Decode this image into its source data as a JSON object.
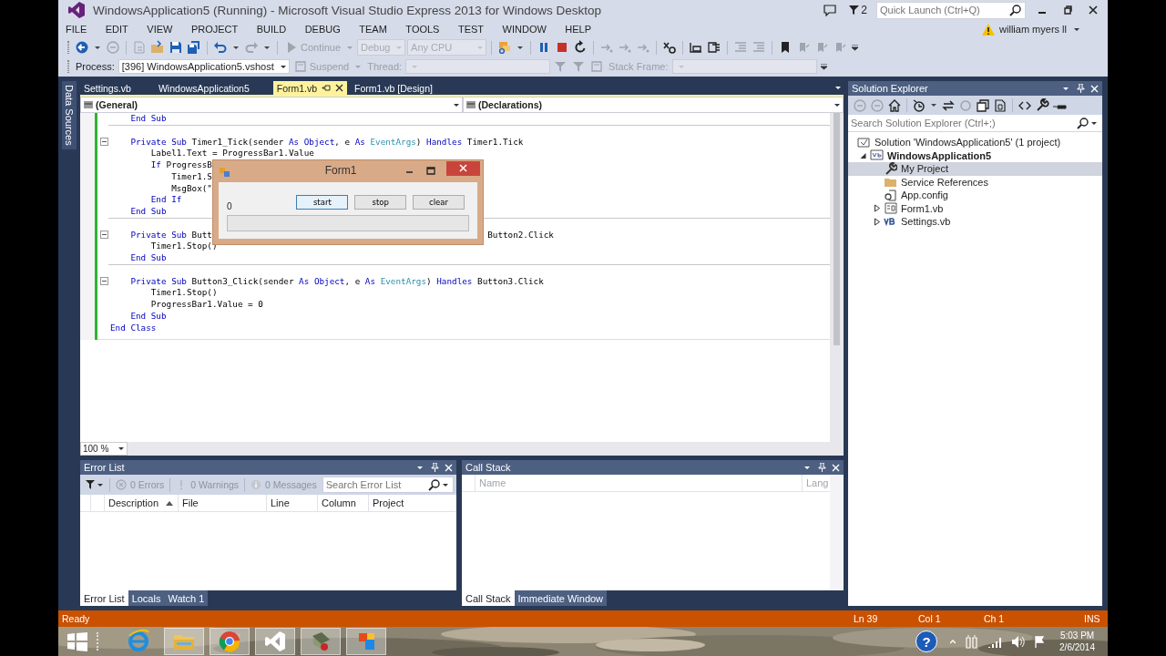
{
  "window": {
    "title": "WindowsApplication5 (Running) - Microsoft Visual Studio Express 2013 for Windows Desktop",
    "notification_count": "2",
    "quick_launch": {
      "placeholder": "Quick Launch (Ctrl+Q)"
    },
    "user": "william myers ll"
  },
  "menu": [
    "FILE",
    "EDIT",
    "VIEW",
    "PROJECT",
    "BUILD",
    "DEBUG",
    "TEAM",
    "TOOLS",
    "TEST",
    "WINDOW",
    "HELP"
  ],
  "toolbar_standard": [
    {
      "kind": "tools"
    },
    {
      "kind": "button",
      "label": "Continue",
      "disabled": true
    },
    {
      "kind": "combo",
      "value": "Debug",
      "disabled": true
    },
    {
      "kind": "combo",
      "value": "Any CPU",
      "disabled": true
    },
    {
      "kind": "tools"
    }
  ],
  "toolbar_debug_location": [
    {
      "kind": "label",
      "text": "Process:",
      "disabled": false
    },
    {
      "kind": "combo",
      "value": "[396] WindowsApplication5.vshost",
      "disabled": false
    },
    {
      "kind": "button",
      "label": "Suspend",
      "disabled": true
    },
    {
      "kind": "label",
      "text": "Thread:",
      "disabled": true
    },
    {
      "kind": "combo",
      "disabled": true
    },
    {
      "kind": "tools"
    },
    {
      "kind": "label",
      "text": "Stack Frame:",
      "disabled": true
    },
    {
      "kind": "combo",
      "disabled": true
    }
  ],
  "side_tab": "Data Sources",
  "editor": {
    "tabs": [
      {
        "label": "Settings.vb",
        "selected": false
      },
      {
        "label": "WindowsApplication5",
        "selected": false
      },
      {
        "label": "Form1.vb",
        "selected": true
      },
      {
        "label": "Form1.vb [Design]",
        "selected": false
      }
    ],
    "member_dropdowns": [
      "(General)",
      "(Declarations)"
    ],
    "code": {
      "members": [
        {
          "tokens": [
            {
              "text": "End Sub",
              "kind": "keyword"
            }
          ]
        },
        {
          "tokens": [
            {
              "text": "Private Sub",
              "kind": "keyword"
            },
            {
              "text": " Timer1_Tick(sender ",
              "kind": "plain"
            },
            {
              "text": "As Object",
              "kind": "keyword"
            },
            {
              "text": ", e ",
              "kind": "plain"
            },
            {
              "text": "As",
              "kind": "keyword"
            },
            {
              "text": " EventArgs",
              "kind": "type"
            },
            {
              "text": ") ",
              "kind": "plain"
            },
            {
              "text": "Handles",
              "kind": "keyword"
            },
            {
              "text": " Timer1.Tick",
              "kind": "plain"
            }
          ],
          "children": [
            {
              "tokens": [
                {
                  "text": "Label1.Text = ProgressBar1.Value",
                  "kind": "plain"
                }
              ]
            },
            {
              "tokens": [
                {
                  "text": "If",
                  "kind": "keyword"
                },
                {
                  "text": " ProgressB",
                  "kind": "plain"
                }
              ],
              "children": [
                {
                  "tokens": [
                    {
                      "text": "Timer1.S",
                      "kind": "plain"
                    }
                  ]
                },
                {
                  "tokens": [
                    {
                      "text": "MsgBox(\"",
                      "kind": "plain"
                    }
                  ]
                }
              ]
            },
            {
              "tokens": [
                {
                  "text": "End If",
                  "kind": "keyword"
                }
              ]
            }
          ]
        },
        {
          "tokens": [
            {
              "text": "End Sub",
              "kind": "keyword"
            }
          ]
        },
        {
          "tokens": [
            {
              "text": "Private Sub",
              "kind": "keyword"
            },
            {
              "text": " Butt",
              "kind": "plain"
            }
          ],
          "tail_tokens": [
            {
              "text": "Button2.Click",
              "kind": "plain"
            }
          ],
          "children": [
            {
              "tokens": [
                {
                  "text": "Timer1.Stop()",
                  "kind": "plain"
                }
              ]
            }
          ]
        },
        {
          "tokens": [
            {
              "text": "End Sub",
              "kind": "keyword"
            }
          ]
        },
        {
          "tokens": [
            {
              "text": "Private Sub",
              "kind": "keyword"
            },
            {
              "text": " Button3_Click(sender ",
              "kind": "plain"
            },
            {
              "text": "As Object",
              "kind": "keyword"
            },
            {
              "text": ", e ",
              "kind": "plain"
            },
            {
              "text": "As",
              "kind": "keyword"
            },
            {
              "text": " EventArgs",
              "kind": "type"
            },
            {
              "text": ") ",
              "kind": "plain"
            },
            {
              "text": "Handles",
              "kind": "keyword"
            },
            {
              "text": " Button3.Click",
              "kind": "plain"
            }
          ],
          "children": [
            {
              "tokens": [
                {
                  "text": "Timer1.Stop()",
                  "kind": "plain"
                }
              ]
            },
            {
              "tokens": [
                {
                  "text": "ProgressBar1.Value = 0",
                  "kind": "plain"
                }
              ]
            }
          ]
        },
        {
          "tokens": [
            {
              "text": "End Sub",
              "kind": "keyword"
            }
          ]
        }
      ],
      "closing": [
        {
          "text": "End Class",
          "kind": "keyword"
        }
      ]
    },
    "zoom": "100 %"
  },
  "running_form": {
    "title": "Form1",
    "label": "0",
    "buttons": [
      {
        "label": "start",
        "focused": true
      },
      {
        "label": "stop",
        "focused": false
      },
      {
        "label": "clear",
        "focused": false
      }
    ],
    "progress": {
      "level": 0
    }
  },
  "error_list": {
    "title": "Error List",
    "filters": [
      {
        "label": "0 Errors",
        "kind": "errors",
        "disabled": true
      },
      {
        "label": "0 Warnings",
        "kind": "warnings",
        "disabled": true
      },
      {
        "label": "0 Messages",
        "kind": "messages",
        "disabled": true
      }
    ],
    "search": {
      "placeholder": "Search Error List"
    },
    "columns": [
      {
        "label": "Description",
        "sorted": true
      },
      {
        "label": "File",
        "sorted": false
      },
      {
        "label": "Line",
        "sorted": false
      },
      {
        "label": "Column",
        "sorted": false
      },
      {
        "label": "Project",
        "sorted": false
      }
    ],
    "tabs": [
      {
        "label": "Error List",
        "selected": true
      },
      {
        "label": "Locals",
        "selected": false
      },
      {
        "label": "Watch 1",
        "selected": false
      }
    ]
  },
  "call_stack": {
    "title": "Call Stack",
    "columns": [
      "Name",
      "Lang"
    ],
    "tabs": [
      {
        "label": "Call Stack",
        "selected": true
      },
      {
        "label": "Immediate Window",
        "selected": false
      }
    ]
  },
  "solution_explorer": {
    "title": "Solution Explorer",
    "search": {
      "placeholder": "Search Solution Explorer (Ctrl+;)"
    },
    "tree": [
      {
        "label": "Solution 'WindowsApplication5' (1 project)",
        "kind": "solution",
        "selected": false
      },
      {
        "label": "WindowsApplication5",
        "kind": "project",
        "selected": false,
        "expanded": true,
        "children": [
          {
            "label": "My Project",
            "kind": "settings",
            "selected": true
          },
          {
            "label": "Service References",
            "kind": "folder",
            "selected": false
          },
          {
            "label": "App.config",
            "kind": "config",
            "selected": false
          },
          {
            "label": "Form1.vb",
            "kind": "form",
            "selected": false,
            "expanded": false
          },
          {
            "label": "Settings.vb",
            "kind": "vbfile",
            "selected": false,
            "expanded": false
          }
        ]
      }
    ]
  },
  "status_bar": [
    "Ready",
    "Ln 39",
    "Col 1",
    "Ch 1",
    "INS"
  ],
  "taskbar": {
    "apps": [
      {
        "kind": "browser",
        "running": false
      },
      {
        "kind": "folder",
        "running": true
      },
      {
        "kind": "web",
        "running": true
      },
      {
        "kind": "studio",
        "running": true
      },
      {
        "kind": "tool",
        "running": true
      },
      {
        "kind": "form",
        "running": true
      }
    ],
    "help_glyph": "?",
    "time": "5:03 PM",
    "date": "2/6/2014"
  }
}
